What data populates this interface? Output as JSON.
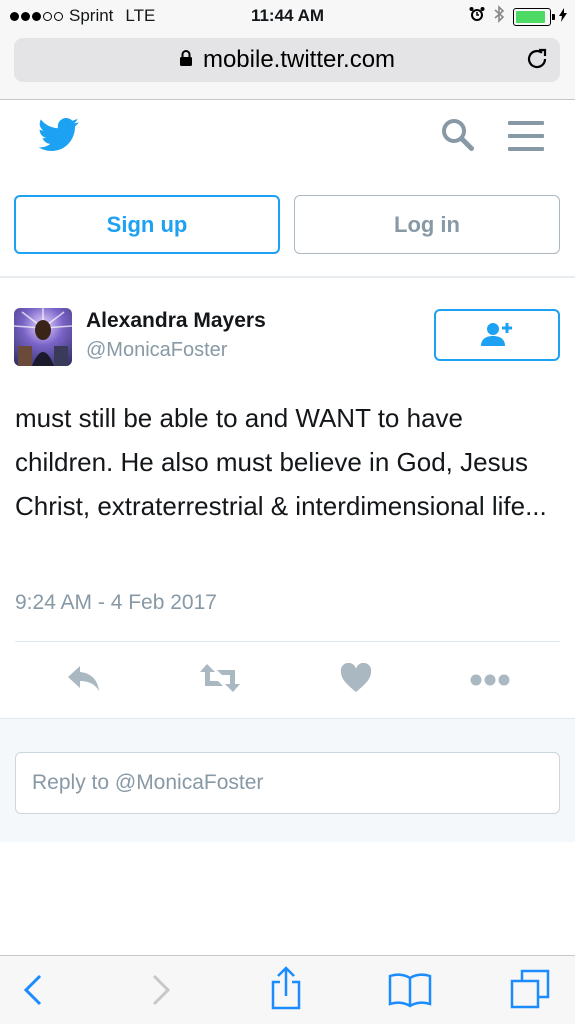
{
  "status_bar": {
    "carrier": "Sprint",
    "network": "LTE",
    "time": "11:44 AM",
    "battery_level": 0.9
  },
  "browser": {
    "url": "mobile.twitter.com"
  },
  "header": {
    "logo_icon": "twitter-bird-icon",
    "search_icon": "search-icon",
    "menu_icon": "hamburger-menu-icon"
  },
  "auth": {
    "signup_label": "Sign up",
    "login_label": "Log in"
  },
  "tweet": {
    "user_name": "Alexandra Mayers",
    "user_handle": "@MonicaFoster",
    "text": "must still be able to and WANT to have children. He also must believe in God, Jesus Christ, extraterrestrial & interdimensional life...",
    "timestamp": "9:24 AM - 4 Feb 2017",
    "actions": [
      "reply-icon",
      "retweet-icon",
      "like-icon",
      "more-icon"
    ]
  },
  "reply": {
    "placeholder": "Reply to @MonicaFoster"
  },
  "colors": {
    "brand": "#1da1f2",
    "muted": "#8899a6",
    "action_icons": "#aab8c2",
    "battery": "#4cd964"
  }
}
